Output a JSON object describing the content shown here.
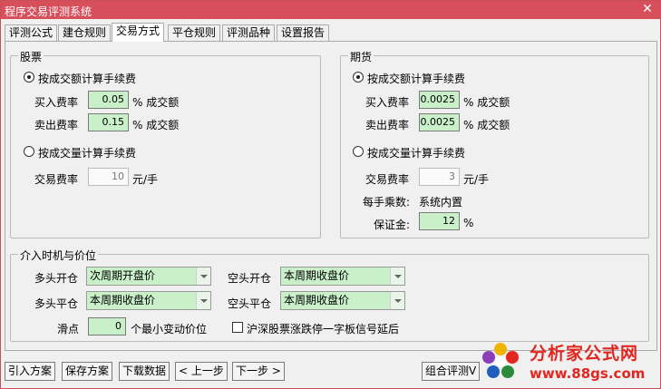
{
  "window": {
    "title": "程序交易评测系统",
    "close_glyph": "✕"
  },
  "tabs": [
    "评测公式",
    "建仓规则",
    "交易方式",
    "平仓规则",
    "评测品种",
    "设置报告"
  ],
  "stock": {
    "legend": "股票",
    "by_amount_label": "按成交额计算手续费",
    "buy_rate_label": "买入费率",
    "buy_rate_value": "0.05",
    "buy_rate_unit": "% 成交额",
    "sell_rate_label": "卖出费率",
    "sell_rate_value": "0.15",
    "sell_rate_unit": "% 成交额",
    "by_volume_label": "按成交量计算手续费",
    "trade_fee_label": "交易费率",
    "trade_fee_value": "10",
    "trade_fee_unit": "元/手"
  },
  "futures": {
    "legend": "期货",
    "by_amount_label": "按成交额计算手续费",
    "buy_rate_label": "买入费率",
    "buy_rate_value": "0.0025",
    "buy_rate_unit": "% 成交额",
    "sell_rate_label": "卖出费率",
    "sell_rate_value": "0.0025",
    "sell_rate_unit": "% 成交额",
    "by_volume_label": "按成交量计算手续费",
    "trade_fee_label": "交易费率",
    "trade_fee_value": "3",
    "trade_fee_unit": "元/手",
    "multiplier_label": "每手乘数:",
    "multiplier_value": "系统内置",
    "margin_label": "保证金:",
    "margin_value": "12",
    "margin_unit": "%"
  },
  "entry": {
    "legend": "介入时机与价位",
    "long_open_label": "多头开仓",
    "long_open_value": "次周期开盘价",
    "short_open_label": "空头开仓",
    "short_open_value": "本周期收盘价",
    "long_close_label": "多头平仓",
    "long_close_value": "本周期收盘价",
    "short_close_label": "空头平仓",
    "short_close_value": "本周期收盘价",
    "slippage_label": "滑点",
    "slippage_value": "0",
    "slippage_unit": "个最小变动价位",
    "limit_delay_label": "沪深股票涨跌停一字板信号延后"
  },
  "buttons": {
    "import": "引入方案",
    "save": "保存方案",
    "download": "下载数据",
    "prev": "< 上一步",
    "next": "下一步 >",
    "combo": "组合评测V"
  },
  "logo": {
    "line1": "分析家公式网",
    "line2": "www.88gs.com"
  },
  "colors": {
    "titlebar": "#d64f5b",
    "field_bg": "#c9f0c9",
    "logo_red": "#e3261f"
  }
}
